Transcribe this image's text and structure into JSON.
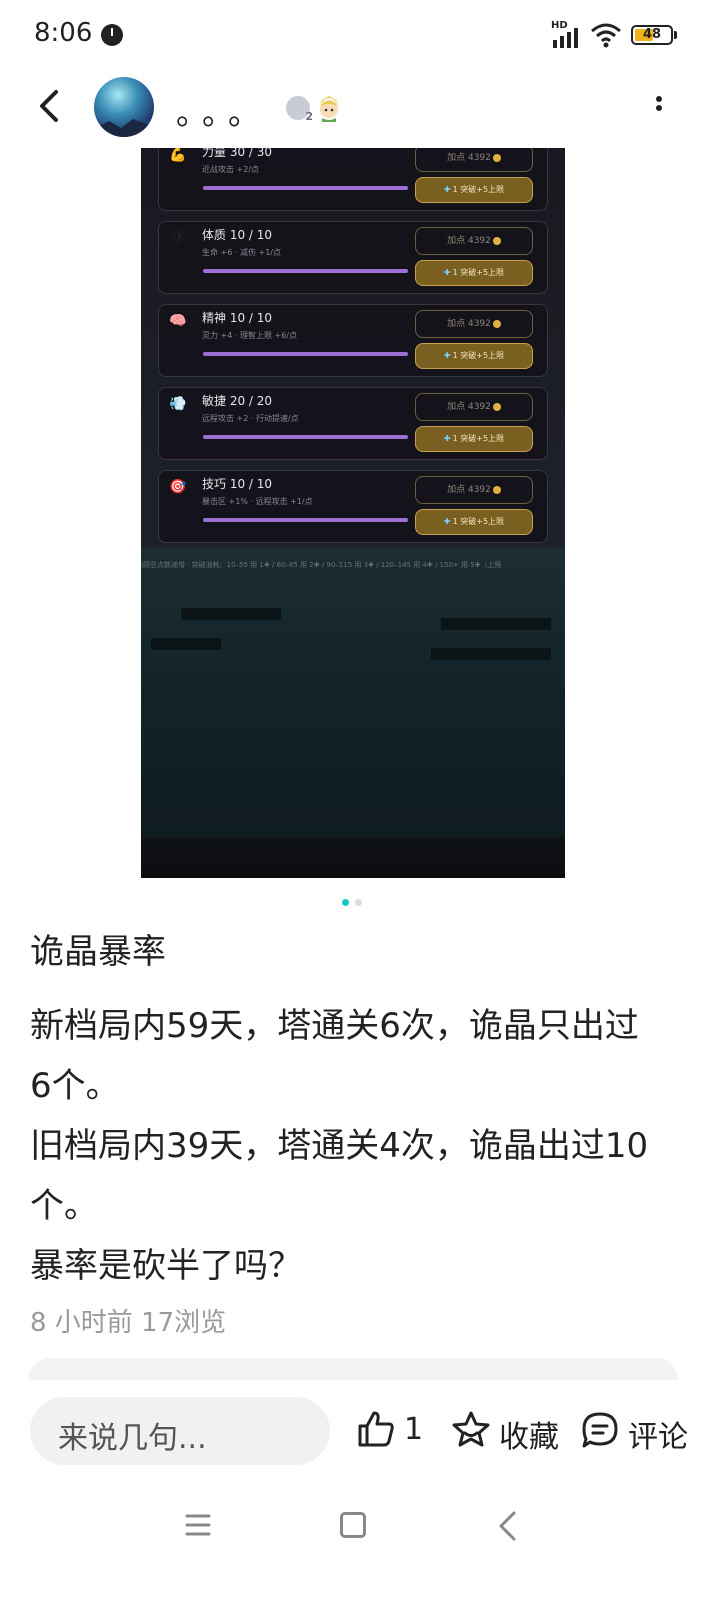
{
  "status_bar": {
    "time": "8:06",
    "network": "HD",
    "battery": "48",
    "icons": [
      "clock-icon",
      "signal-icon",
      "wifi-icon",
      "battery-icon"
    ]
  },
  "header": {
    "username": "。。。",
    "level": "2",
    "icons": [
      "back-arrow-icon",
      "avatar",
      "level-badge-icon",
      "character-badge-icon",
      "more-vertical-icon"
    ]
  },
  "post_image": {
    "stats": [
      {
        "icon": "💪",
        "title": "力量  30 / 30",
        "desc": "近战攻击 +2/点",
        "add_label": "加点 4392",
        "break_label": "1 突破+5上限"
      },
      {
        "icon": "🛡",
        "title": "体质  10 / 10",
        "desc": "生命 +6 · 减伤 +1/点",
        "add_label": "加点 4392",
        "break_label": "1 突破+5上限"
      },
      {
        "icon": "🧠",
        "title": "精神  10 / 10",
        "desc": "灵力 +4 · 理智上限 +6/点",
        "add_label": "加点 4392",
        "break_label": "1 突破+5上限"
      },
      {
        "icon": "💨",
        "title": "敏捷  20 / 20",
        "desc": "远程攻击 +2 · 行动提速/点",
        "add_label": "加点 4392",
        "break_label": "1 突破+5上限"
      },
      {
        "icon": "🎯",
        "title": "技巧  10 / 10",
        "desc": "暴击区 +1% · 远程攻击 +1/点",
        "add_label": "加点 4392",
        "break_label": "1 突破+5上限"
      }
    ],
    "footer_text": "l顾总点数递增 · 突破消耗：10–55 用 1✚ / 60–85 用 2✚ / 90–115 用 3✚ / 120–145 用 4✚ / 150+ 用 5✚（上限"
  },
  "pager": {
    "count": 2,
    "active": 0,
    "active_color": "#19c6c6",
    "inactive_color": "#dcdcdc"
  },
  "post": {
    "title": "诡晶暴率",
    "body_lines": [
      "新档局内59天，塔通关6次，诡晶只出过",
      "6个。",
      "旧档局内39天，塔通关4次，诡晶出过10",
      "个。",
      "暴率是砍半了吗？"
    ],
    "meta": "8 小时前  17浏览"
  },
  "bottom_bar": {
    "comment_placeholder": "来说几句...",
    "like_count": "1",
    "collect_label": "收藏",
    "comment_label": "评论",
    "icons": [
      "thumb-up-icon",
      "star-icon",
      "comment-bubble-icon"
    ]
  },
  "nav_bar": {
    "icons": [
      "menu-icon",
      "home-square-icon",
      "back-chevron-icon"
    ]
  },
  "colors": {
    "accent": "#19c6c6",
    "bar_purple": "#9c6fd4",
    "gold": "#c9a050"
  }
}
